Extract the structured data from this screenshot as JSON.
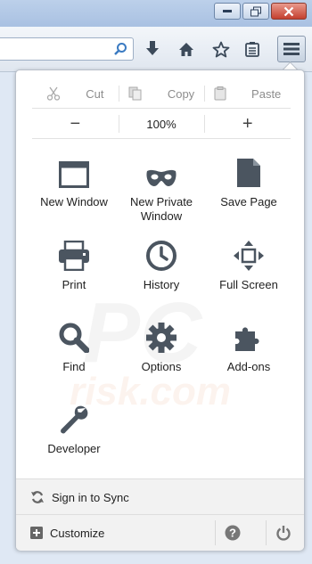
{
  "edit": {
    "cut": "Cut",
    "copy": "Copy",
    "paste": "Paste"
  },
  "zoom": {
    "out": "−",
    "level": "100%",
    "in": "+"
  },
  "items": [
    {
      "label": "New Window",
      "icon": "window-icon"
    },
    {
      "label": "New Private Window",
      "icon": "mask-icon"
    },
    {
      "label": "Save Page",
      "icon": "page-icon"
    },
    {
      "label": "Print",
      "icon": "printer-icon"
    },
    {
      "label": "History",
      "icon": "clock-icon"
    },
    {
      "label": "Full Screen",
      "icon": "fullscreen-icon"
    },
    {
      "label": "Find",
      "icon": "magnifier-icon"
    },
    {
      "label": "Options",
      "icon": "gear-icon"
    },
    {
      "label": "Add-ons",
      "icon": "puzzle-icon"
    },
    {
      "label": "Developer",
      "icon": "wrench-icon"
    }
  ],
  "footer": {
    "sync": "Sign in to Sync",
    "customize": "Customize"
  },
  "watermark": {
    "top": "PC",
    "bottom": "risk.com"
  },
  "colors": {
    "icon": "#4b5560",
    "close": "#c4402f",
    "panel_border": "#b9c0ca"
  }
}
